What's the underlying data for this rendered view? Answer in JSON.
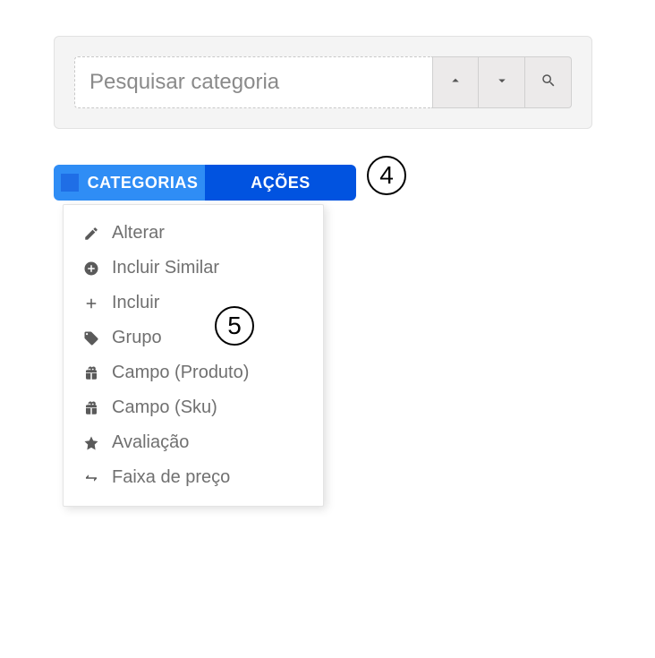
{
  "search": {
    "placeholder": "Pesquisar categoria"
  },
  "tabs": {
    "categorias": "CATEGORIAS",
    "acoes": "AÇÕES"
  },
  "actions": [
    {
      "label": "Alterar"
    },
    {
      "label": "Incluir Similar"
    },
    {
      "label": "Incluir"
    },
    {
      "label": "Grupo"
    },
    {
      "label": "Campo (Produto)"
    },
    {
      "label": "Campo (Sku)"
    },
    {
      "label": "Avaliação"
    },
    {
      "label": "Faixa de preço"
    }
  ],
  "annotations": {
    "badge4": "4",
    "badge5": "5"
  }
}
